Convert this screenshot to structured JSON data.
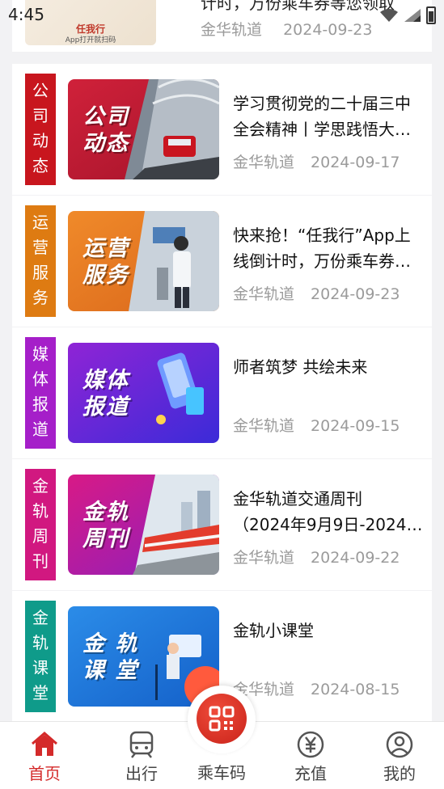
{
  "status_bar": {
    "time": "4:45"
  },
  "top_item": {
    "thumb_text": "任我行",
    "thumb_sub": "App打开就扫码",
    "title_cut": "计时，万份乘车券等您领取",
    "source": "金华轨道",
    "date": "2024-09-23"
  },
  "items": [
    {
      "tag": [
        "公",
        "司",
        "动",
        "态"
      ],
      "tag_color": "#c8161e",
      "thumb_label": [
        "公司",
        "动态"
      ],
      "title_lines": [
        "学习贯彻党的二十届三中",
        "全会精神丨学思践悟大…"
      ],
      "source": "金华轨道",
      "date": "2024-09-17"
    },
    {
      "tag": [
        "运",
        "营",
        "服",
        "务"
      ],
      "tag_color": "#de7b12",
      "thumb_label": [
        "运营",
        "服务"
      ],
      "title_lines": [
        "快来抢！“任我行”App上",
        "线倒计时，万份乘车券…"
      ],
      "source": "金华轨道",
      "date": "2024-09-23"
    },
    {
      "tag": [
        "媒",
        "体",
        "报",
        "道"
      ],
      "tag_color": "#a51fc9",
      "thumb_label": [
        "媒体",
        "报道"
      ],
      "title_lines": [
        "师者筑梦 共绘未来"
      ],
      "source": "金华轨道",
      "date": "2024-09-15"
    },
    {
      "tag": [
        "金",
        "轨",
        "周",
        "刊"
      ],
      "tag_color": "#d11880",
      "thumb_label": [
        "金轨",
        "周刊"
      ],
      "title_lines": [
        "金华轨道交通周刊",
        "（2024年9月9日-2024…"
      ],
      "source": "金华轨道",
      "date": "2024-09-22"
    },
    {
      "tag": [
        "金",
        "轨",
        "课",
        "堂"
      ],
      "tag_color": "#0f9b8a",
      "thumb_label": [
        "金 轨",
        "课 堂"
      ],
      "title_lines": [
        "金轨小课堂"
      ],
      "source": "金华轨道",
      "date": "2024-08-15"
    }
  ],
  "tabbar": {
    "home": "首页",
    "travel": "出行",
    "ride_code": "乘车码",
    "recharge": "充值",
    "mine": "我的",
    "active_color": "#d42a2a"
  }
}
